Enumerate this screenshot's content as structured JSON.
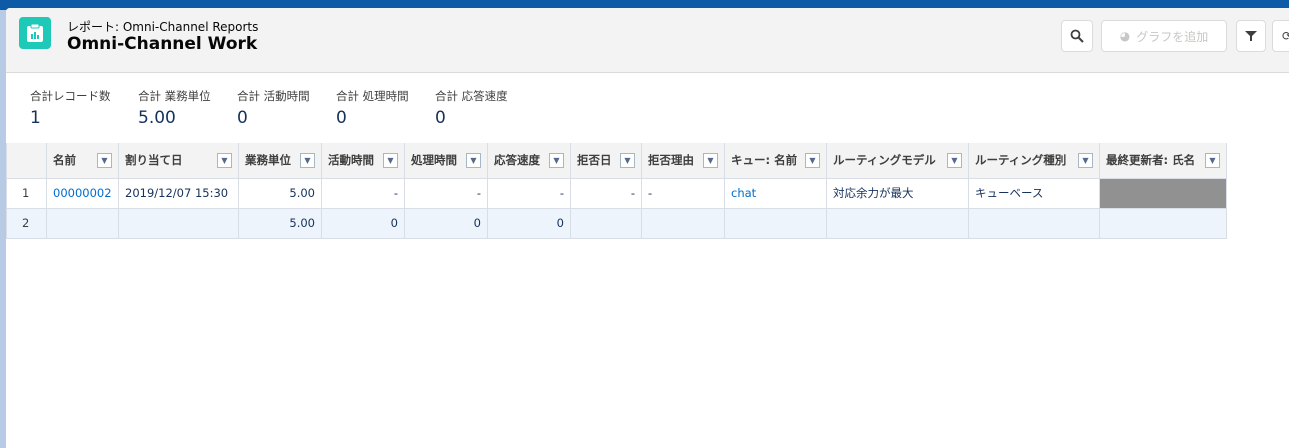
{
  "header": {
    "subtitle": "レポート: Omni-Channel Reports",
    "title": "Omni-Channel Work",
    "add_chart_label": "グラフを追加"
  },
  "summary": [
    {
      "label": "合計レコード数",
      "value": "1"
    },
    {
      "label": "合計 業務単位",
      "value": "5.00"
    },
    {
      "label": "合計 活動時間",
      "value": "0"
    },
    {
      "label": "合計 処理時間",
      "value": "0"
    },
    {
      "label": "合計 応答速度",
      "value": "0"
    }
  ],
  "table": {
    "columns": [
      "名前",
      "割り当て日",
      "業務単位",
      "活動時間",
      "処理時間",
      "応答速度",
      "拒否日",
      "拒否理由",
      "キュー: 名前",
      "ルーティングモデル",
      "ルーティング種別",
      "最終更新者: 氏名"
    ],
    "rows": [
      [
        "1",
        "00000002",
        "2019/12/07 15:30",
        "5.00",
        "-",
        "-",
        "-",
        "-",
        "-",
        "chat",
        "対応余力が最大",
        "キューベース",
        ""
      ],
      [
        "2",
        "",
        "",
        "5.00",
        "0",
        "0",
        "0",
        "",
        "",
        "",
        "",
        "",
        ""
      ]
    ]
  },
  "colors": {
    "accent": "#1fc9b8",
    "link": "#006dcc",
    "banner": "#0d5aa7"
  }
}
